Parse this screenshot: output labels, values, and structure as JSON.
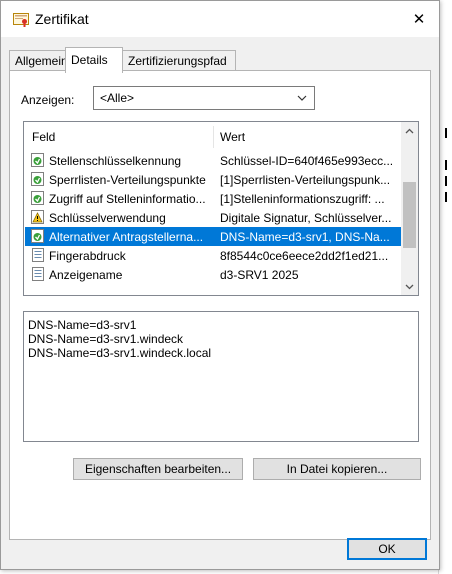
{
  "window": {
    "title": "Zertifikat",
    "close_symbol": "✕"
  },
  "tabs": [
    {
      "label": "Allgemein",
      "active": false
    },
    {
      "label": "Details",
      "active": true
    },
    {
      "label": "Zertifizierungspfad",
      "active": false
    }
  ],
  "show": {
    "label": "Anzeigen:",
    "value": "<Alle>"
  },
  "list": {
    "columns": {
      "field": "Feld",
      "value": "Wert"
    },
    "rows": [
      {
        "field": "Stellenschlüsselkennung",
        "value": "Schlüssel-ID=640f465e993ecc...",
        "icon": "extension-icon",
        "selected": false
      },
      {
        "field": "Sperrlisten-Verteilungspunkte",
        "value": "[1]Sperrlisten-Verteilungspunk...",
        "icon": "extension-icon",
        "selected": false
      },
      {
        "field": "Zugriff auf Stelleninformatio...",
        "value": "[1]Stelleninformationszugriff: ...",
        "icon": "extension-icon",
        "selected": false
      },
      {
        "field": "Schlüsselverwendung",
        "value": "Digitale Signatur, Schlüsselver...",
        "icon": "critical-extension-icon",
        "selected": false
      },
      {
        "field": "Alternativer Antragstellerna...",
        "value": "DNS-Name=d3-srv1, DNS-Na...",
        "icon": "extension-icon",
        "selected": true
      },
      {
        "field": "Fingerabdruck",
        "value": "8f8544c0ce6eece2dd2f1ed21...",
        "icon": "property-icon",
        "selected": false
      },
      {
        "field": "Anzeigename",
        "value": "d3-SRV1 2025",
        "icon": "property-icon",
        "selected": false
      }
    ]
  },
  "detail": {
    "lines": [
      "DNS-Name=d3-srv1",
      "DNS-Name=d3-srv1.windeck",
      "DNS-Name=d3-srv1.windeck.local"
    ]
  },
  "buttons": {
    "edit_properties": "Eigenschaften bearbeiten...",
    "copy_to_file": "In Datei kopieren...",
    "ok": "OK"
  },
  "colors": {
    "selection": "#0078d7",
    "dialog_bg": "#f0f0f0",
    "accent": "#0078d7"
  }
}
